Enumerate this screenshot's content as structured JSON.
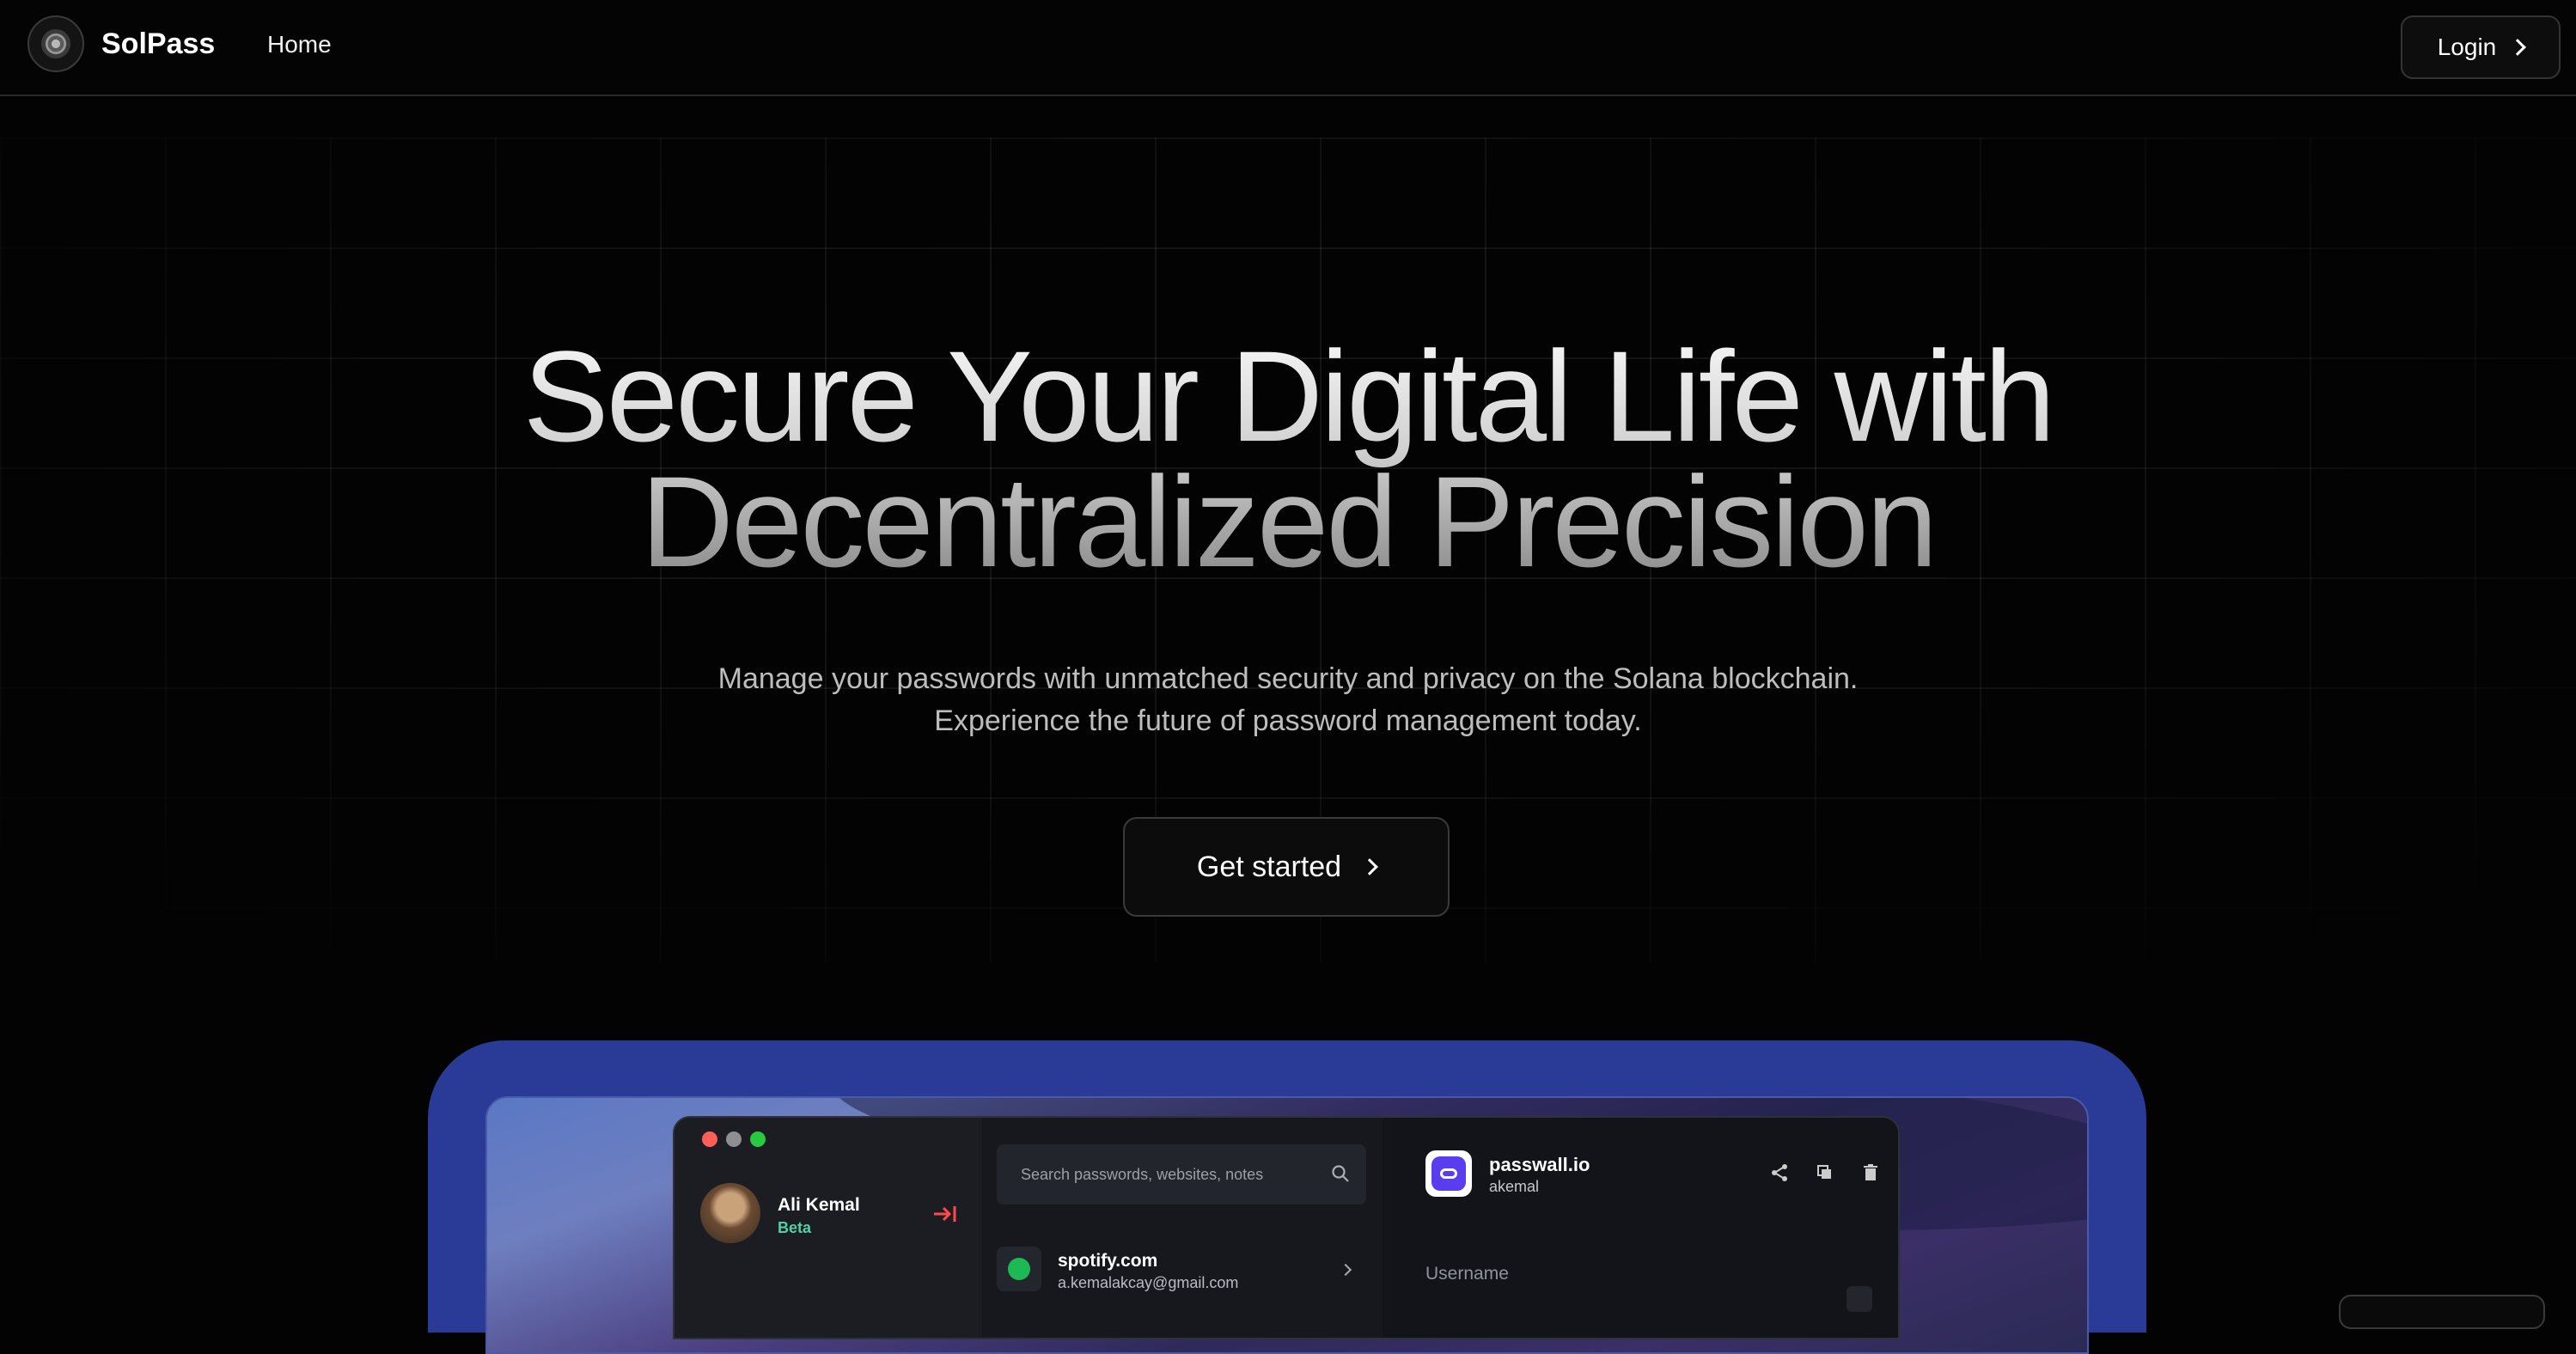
{
  "nav": {
    "brand": "SolPass",
    "links": [
      "Home"
    ],
    "login_label": "Login"
  },
  "hero": {
    "title_line1": "Secure Your Digital Life with",
    "title_line2": "Decentralized Precision",
    "subtitle_line1": "Manage your passwords with unmatched security and privacy on the Solana blockchain.",
    "subtitle_line2": "Experience the future of password management today.",
    "cta_label": "Get started"
  },
  "mockup": {
    "user": {
      "name": "Ali Kemal",
      "tag": "Beta"
    },
    "search_placeholder": "Search passwords, websites, notes",
    "list": [
      {
        "title": "spotify.com",
        "subtitle": "a.kemalakcay@gmail.com",
        "icon": "spotify-icon"
      }
    ],
    "detail": {
      "title": "passwall.io",
      "subtitle": "akemal",
      "field_label": "Username",
      "actions": [
        "share-icon",
        "copy-icon",
        "trash-icon"
      ]
    },
    "window_controls": {
      "close": "#ff5f57",
      "minimize": "#8e8e93",
      "maximize": "#28c840"
    }
  },
  "colors": {
    "background": "#030303",
    "frame_blue": "#2a3b97",
    "accent_green": "#4fd1a5",
    "collapse_red": "#ff4a4a"
  }
}
